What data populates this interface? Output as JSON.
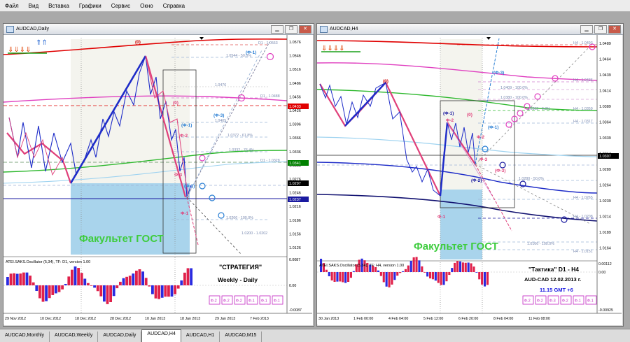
{
  "menu": [
    "Файл",
    "Вид",
    "Вставка",
    "Графики",
    "Сервис",
    "Окно",
    "Справка"
  ],
  "left_window": {
    "title": "AUDCAD,Daily",
    "watermark": "Факультет ГОСТ",
    "indicator": "ATEI.SAKS.Oscillator (5,34), TF: D1, version 1.00",
    "strategy_title": "\"СТРАТЕГИЯ\"",
    "strategy_sub": "Weekly - Daily",
    "right_axis": [
      "1.0576",
      "1.0546",
      "1.0516",
      "1.0486",
      "1.0456",
      "1.0426",
      "1.0396",
      "1.0366",
      "1.0336",
      "1.0306",
      "1.0276",
      "1.0246",
      "1.0216",
      "1.0186",
      "1.0156",
      "1.0126"
    ],
    "price_tags": [
      {
        "text": "1.0433",
        "color": "#e00000"
      },
      {
        "text": "1.0341",
        "color": "#008000"
      },
      {
        "text": "1.0297",
        "color": "#000000"
      },
      {
        "text": "1.0237",
        "color": "#1a1aa0"
      }
    ],
    "level_labels": [
      "D1 - 1.0563",
      "1.0544 - 50.0%",
      "1.0476",
      "D1 - 1.0488",
      "1.0405",
      "1.0372 - 61.8%",
      "1.0332 - 76.4%",
      "D1 - 1.0328",
      "1.0266 - 100.0%",
      "1.0200 - 1.0202"
    ],
    "osc_axis": [
      "0.0087",
      "0.00",
      "-0.0087"
    ],
    "time_axis": [
      "29 Nov 2012",
      "10 Dec 2012",
      "18 Dec 2012",
      "28 Dec 2012",
      "10 Jan 2013",
      "18 Jan 2013",
      "29 Jan 2013",
      "7 Feb 2013"
    ],
    "phi_buttons": [
      "Φ-2",
      "Φ-2",
      "Φ-2",
      "Φ-1",
      "Φ-1",
      "Φ-1"
    ],
    "wave_labels": [
      {
        "t": "(0)",
        "c": "#cc0000"
      },
      {
        "t": "(Φ-1)",
        "c": "#2a7fd4"
      },
      {
        "t": "(0)",
        "c": "#e0407a"
      },
      {
        "t": "(Φ-1)",
        "c": "#2a7fd4"
      },
      {
        "t": "Φ-2",
        "c": "#e0407a"
      },
      {
        "t": "(Φ-3)",
        "c": "#2a7fd4"
      },
      {
        "t": "Φ-3",
        "c": "#e0407a"
      },
      {
        "t": "(Φ-2)",
        "c": "#2a7fd4"
      },
      {
        "t": "Φ-1",
        "c": "#e0407a"
      }
    ]
  },
  "right_window": {
    "title": "AUDCAD,H4",
    "watermark": "Факультет ГОСТ",
    "indicator": "ATEI.SAKS.Oscillator (5,34), TF: H4, version 1.00",
    "tactics_title": "\"Тактика\"  D1 - H4",
    "tactics_line2": "AUD-CAD     12.02.2013  г.",
    "tactics_line3": "11.15  GMT +6",
    "right_axis": [
      "1.0489",
      "1.0464",
      "1.0439",
      "1.0414",
      "1.0389",
      "1.0364",
      "1.0339",
      "1.0314",
      "1.0289",
      "1.0264",
      "1.0239",
      "1.0214",
      "1.0189",
      "1.0164"
    ],
    "price_tags": [
      {
        "text": "1.0307",
        "color": "#000000"
      }
    ],
    "level_labels": [
      "H4 - 1.0493",
      "H4 - 1.0436",
      "1.0409 - 100.0%",
      "1.0380 - 100.0%",
      "1.0362 - 0.0%",
      "H4 - 1.0359",
      "H4 - 1.0317",
      "1.0280 - 50.0%",
      "H4 - 1.0265",
      "H4 - 1.0208",
      "1.0166 - 100.0%",
      "H4 - 1.0151"
    ],
    "osc_axis": [
      "0.00112",
      "0.00",
      "-0.00925"
    ],
    "time_axis": [
      "30 Jan 2013",
      "1 Feb 00:00",
      "4 Feb 04:00",
      "5 Feb 12:00",
      "6 Feb 20:00",
      "8 Feb 04:00",
      "11 Feb 08:00"
    ],
    "phi_buttons": [
      "Φ-2",
      "Φ-2",
      "Φ-3",
      "Φ-2",
      "Φ-1",
      "Φ-1"
    ],
    "wave_labels": [
      {
        "t": "(Φ-3)",
        "c": "#2a7fd4"
      },
      {
        "t": "(0)",
        "c": "#cc0000"
      },
      {
        "t": "(Φ-1)",
        "c": "#1a1aa0"
      },
      {
        "t": "Φ-2",
        "c": "#e0407a"
      },
      {
        "t": "(0)",
        "c": "#e0407a"
      },
      {
        "t": "(Φ-1)",
        "c": "#2a7fd4"
      },
      {
        "t": "Φ-2",
        "c": "#e0407a"
      },
      {
        "t": "Φ-3",
        "c": "#e0407a"
      },
      {
        "t": "(Φ-3)",
        "c": "#e0407a"
      },
      {
        "t": "(Φ-2)",
        "c": "#1a1aa0"
      },
      {
        "t": "Φ-1",
        "c": "#e0407a"
      }
    ]
  },
  "tabs": [
    "AUDCAD,Monthly",
    "AUDCAD,Weekly",
    "AUDCAD,Daily",
    "AUDCAD,H4",
    "AUDCAD,H1",
    "AUDCAD,M15"
  ],
  "active_tab": 3,
  "colors": {
    "main_pink": "#e0407a",
    "blue_wave": "#1e2cc8",
    "red_ma": "#e00000",
    "green_ma": "#2eb82e",
    "fill_blue": "#a9d4ec"
  }
}
